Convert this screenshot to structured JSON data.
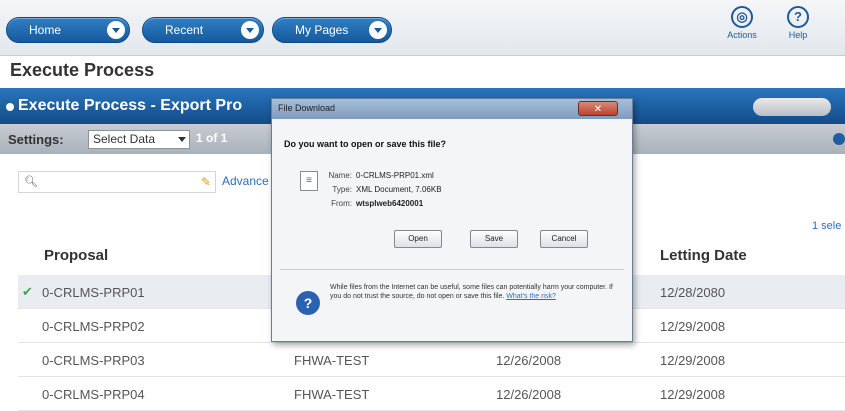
{
  "nav": {
    "home": "Home",
    "recent": "Recent",
    "mypages": "My Pages",
    "actions": "Actions",
    "help": "Help"
  },
  "page_title": "Execute Process",
  "band_title": "Execute Process - Export Pro",
  "settings": {
    "label": "Settings:",
    "select_value": "Select Data",
    "page": "1 of 1"
  },
  "search": {
    "advanced": "Advance"
  },
  "selected_count": "1 sele",
  "table": {
    "headers": {
      "proposal": "Proposal",
      "letting_date": "Letting Date"
    },
    "rows": [
      {
        "proposal": "0-CRLMS-PRP01",
        "agency": "",
        "date": "",
        "letting": "12/28/2080"
      },
      {
        "proposal": "0-CRLMS-PRP02",
        "agency": "",
        "date": "",
        "letting": "12/29/2008"
      },
      {
        "proposal": "0-CRLMS-PRP03",
        "agency": "FHWA-TEST",
        "date": "12/26/2008",
        "letting": "12/29/2008"
      },
      {
        "proposal": "0-CRLMS-PRP04",
        "agency": "FHWA-TEST",
        "date": "12/26/2008",
        "letting": "12/29/2008"
      }
    ]
  },
  "dialog": {
    "title": "File Download",
    "question": "Do you want to open or save this file?",
    "name_key": "Name:",
    "name_val": "0-CRLMS-PRP01.xml",
    "type_key": "Type:",
    "type_val": "XML Document, 7.06KB",
    "from_key": "From:",
    "from_val": "wtsplweb6420001",
    "open": "Open",
    "save": "Save",
    "cancel": "Cancel",
    "warning": "While files from the Internet can be useful, some files can potentially harm your computer. If you do not trust the source, do not open or save this file.",
    "risk_link": "What's the risk?"
  },
  "colors": {
    "brand_blue": "#155a9c",
    "check_green": "#3aa64a"
  }
}
